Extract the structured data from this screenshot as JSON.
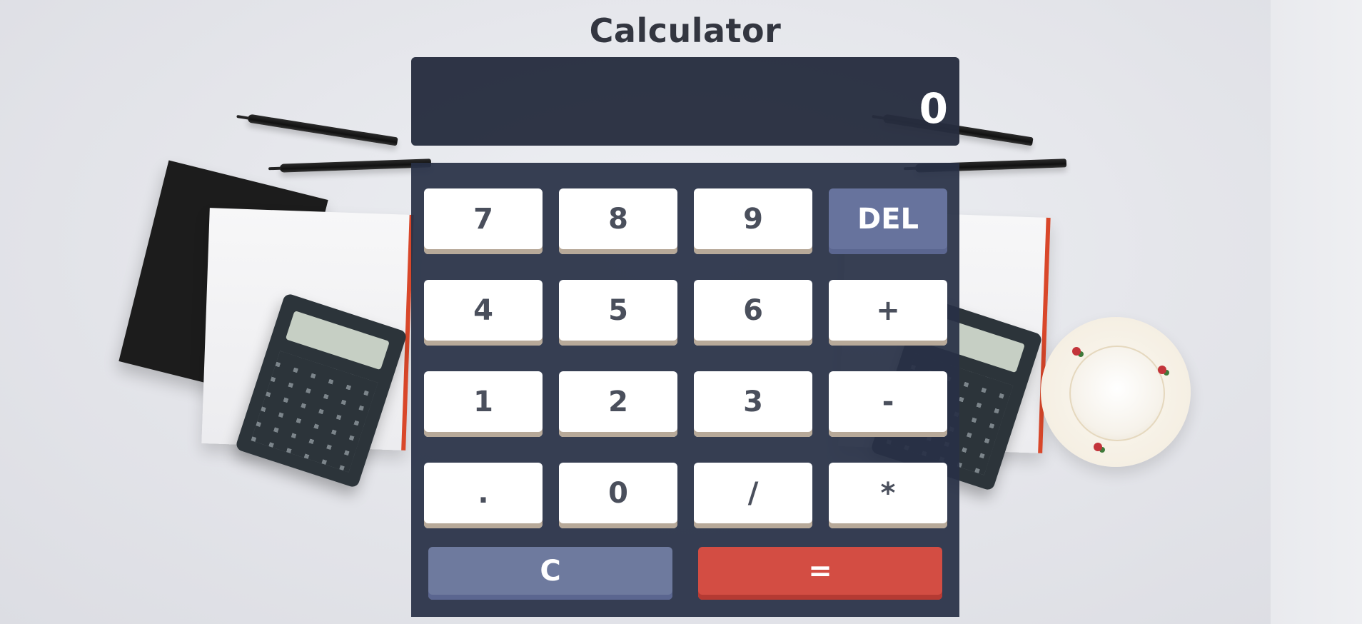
{
  "app": {
    "title": "Calculator"
  },
  "display": {
    "value": "0"
  },
  "keys": {
    "row1": [
      "7",
      "8",
      "9",
      "DEL"
    ],
    "row2": [
      "4",
      "5",
      "6",
      "+"
    ],
    "row3": [
      "1",
      "2",
      "3",
      "-"
    ],
    "row4": [
      ".",
      "0",
      "/",
      "*"
    ],
    "clear": "C",
    "equals": "="
  },
  "colors": {
    "panel": "#283046",
    "display": "#262d3e",
    "key": "#ffffff",
    "key_text": "#4a4f5c",
    "del": "#707daa",
    "clear": "#6e7a9e",
    "equals": "#d34d43"
  },
  "background": {
    "description_icons": [
      "pen-icon",
      "spiral-notebook-icon",
      "notebook-icon",
      "calculator-icon",
      "teacup-icon"
    ]
  }
}
